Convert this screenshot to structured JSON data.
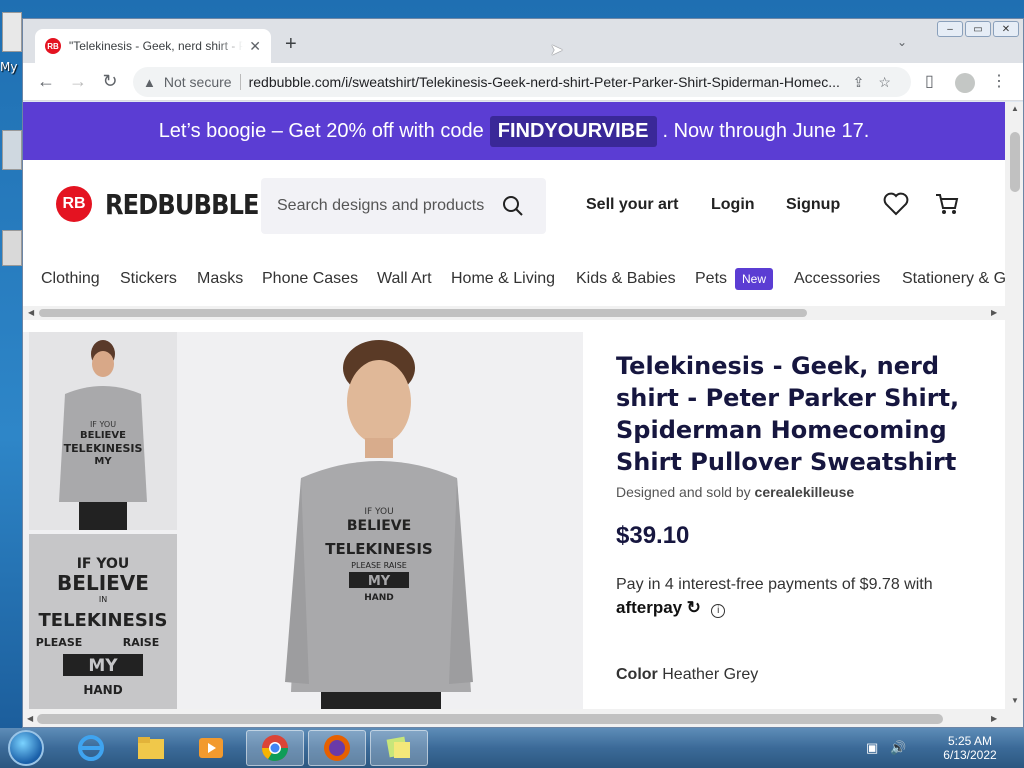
{
  "browser": {
    "tab_title": "\"Telekinesis - Geek, nerd shirt - P",
    "tab_close": "✕",
    "new_tab": "+",
    "not_secure": "Not secure",
    "url": "redbubble.com/i/sweatshirt/Telekinesis-Geek-nerd-shirt-Peter-Parker-Shirt-Spiderman-Homec..."
  },
  "promo": {
    "prefix": "Let’s boogie – Get 20% off with code",
    "code": "FINDYOURVIBE",
    "suffix": ". Now through June 17."
  },
  "header": {
    "logo_text": "REDBUBBLE",
    "search_placeholder": "Search designs and products",
    "sell": "Sell your art",
    "login": "Login",
    "signup": "Signup"
  },
  "categories": {
    "clothing": "Clothing",
    "stickers": "Stickers",
    "masks": "Masks",
    "phone_cases": "Phone Cases",
    "wall_art": "Wall Art",
    "home_living": "Home & Living",
    "kids": "Kids & Babies",
    "pets": "Pets",
    "new_badge": "New",
    "accessories": "Accessories",
    "stationery": "Stationery & G"
  },
  "product": {
    "title": "Telekinesis - Geek, nerd shirt - Peter Parker Shirt, Spiderman Homecoming Shirt Pullover Sweatshirt",
    "seller_prefix": "Designed and sold by",
    "seller": "cerealekilleuse",
    "price": "$39.10",
    "pay_text": "Pay in 4 interest-free payments of $9.78 with",
    "afterpay": "afterpay",
    "color_label": "Color",
    "color_value": "Heather Grey",
    "design_lines": [
      "IF YOU",
      "BELIEVE",
      "IN",
      "TELEKINESIS",
      "PLEASE",
      "RAISE",
      "MY",
      "HAND"
    ]
  },
  "taskbar": {
    "time": "5:25 AM",
    "date": "6/13/2022"
  },
  "desktop": {
    "icon_label": "My"
  },
  "colors": {
    "promo": "#5b3dd3",
    "brand_red": "#e41321",
    "title": "#16163f"
  }
}
